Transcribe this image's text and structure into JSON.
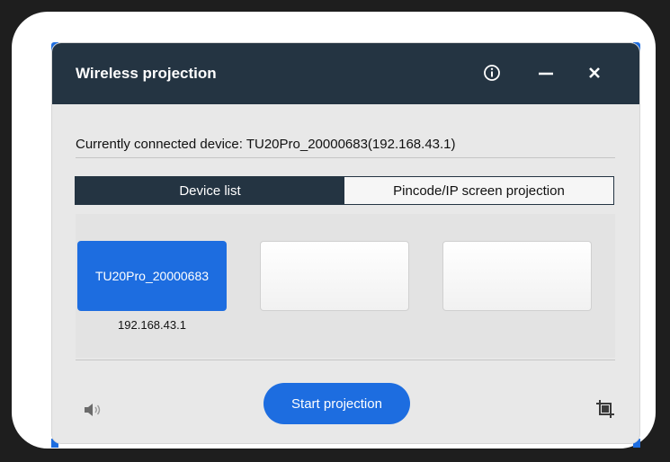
{
  "window": {
    "title": "Wireless projection"
  },
  "titlebar": {
    "info_icon": "info-circle-icon",
    "minimize_icon": "minimize-icon",
    "close_icon": "close-icon"
  },
  "connection": {
    "text": "Currently connected device: TU20Pro_20000683(192.168.43.1)"
  },
  "tabs": [
    {
      "label": "Device list",
      "active": true
    },
    {
      "label": "Pincode/IP screen projection",
      "active": false
    }
  ],
  "devices": [
    {
      "name": "TU20Pro_20000683",
      "ip": "192.168.43.1",
      "selected": true
    },
    {
      "name": "",
      "ip": "",
      "selected": false
    },
    {
      "name": "",
      "ip": "",
      "selected": false
    }
  ],
  "footer": {
    "start_label": "Start projection",
    "volume_icon": "speaker-icon",
    "crop_icon": "crop-icon"
  },
  "colors": {
    "titlebar": "#243442",
    "accent": "#1d6de0",
    "panel": "#e8e8e8"
  }
}
